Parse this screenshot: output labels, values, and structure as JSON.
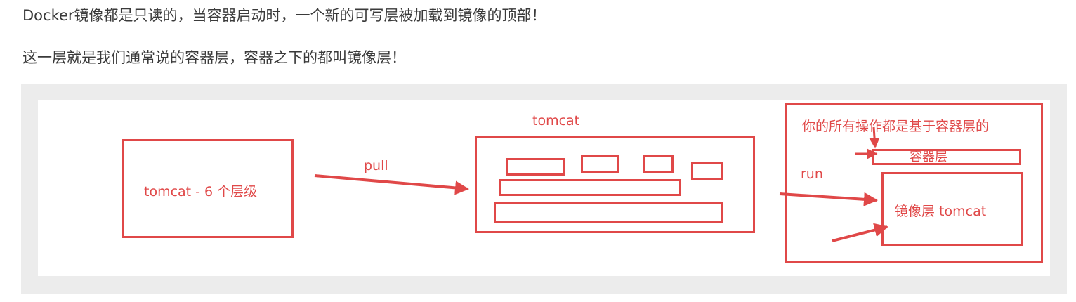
{
  "text": {
    "line1": "Docker镜像都是只读的，当容器启动时，一个新的可写层被加载到镜像的顶部！",
    "line2": "这一层就是我们通常说的容器层，容器之下的都叫镜像层！"
  },
  "diagram": {
    "image_box_label": "tomcat - 6 个层级",
    "pull_label": "pull",
    "tomcat_label": "tomcat",
    "run_label": "run",
    "note_label": "你的所有操作都是基于容器层的",
    "container_layer_label": "容器层",
    "image_layer_label": "镜像层 tomcat",
    "accent_color": "#e04848",
    "background_color": "#ececec"
  }
}
